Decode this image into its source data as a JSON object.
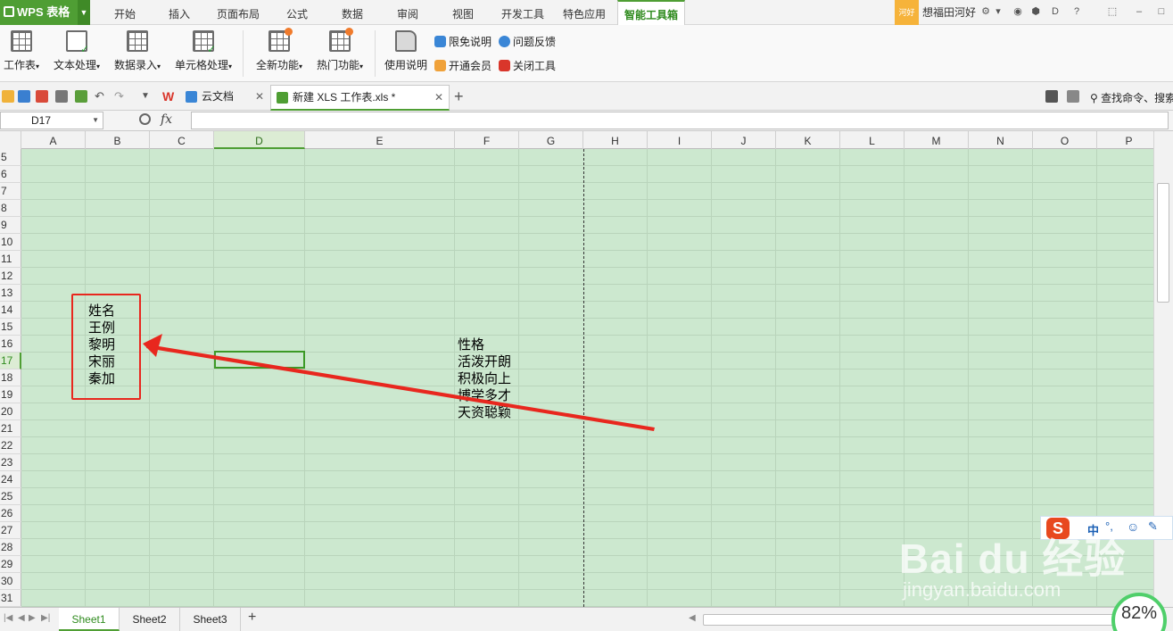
{
  "app": {
    "title": "WPS 表格"
  },
  "menu": {
    "tabs": [
      "开始",
      "插入",
      "页面布局",
      "公式",
      "数据",
      "审阅",
      "视图",
      "开发工具",
      "特色应用",
      "智能工具箱"
    ],
    "active_tab": "智能工具箱"
  },
  "user": {
    "badge": "河好",
    "name": "想福田河好"
  },
  "ribbon": {
    "items": [
      "工作表",
      "文本处理",
      "数据录入",
      "单元格处理",
      "全新功能",
      "热门功能",
      "使用说明"
    ],
    "small": [
      "限免说明",
      "问题反馈",
      "开通会员",
      "关闭工具"
    ]
  },
  "doc_tabs": {
    "cloud": "云文档",
    "file": "新建 XLS 工作表.xls *",
    "search": "查找命令、搜索"
  },
  "formula": {
    "name_box": "D17",
    "fx": "fx",
    "value": ""
  },
  "sheet": {
    "columns": [
      "A",
      "B",
      "C",
      "D",
      "E",
      "F",
      "G",
      "H",
      "I",
      "J",
      "K",
      "L",
      "M",
      "N",
      "O",
      "P"
    ],
    "selected_column": "D",
    "rows": [
      "5",
      "6",
      "7",
      "8",
      "9",
      "10",
      "11",
      "12",
      "13",
      "14",
      "15",
      "16",
      "17",
      "18",
      "19",
      "20",
      "21",
      "22",
      "23",
      "24",
      "25",
      "26",
      "27",
      "28",
      "29",
      "30",
      "31"
    ],
    "selected_row": "17",
    "column_b": [
      "姓名",
      "王例",
      "黎明",
      "宋丽",
      "秦加"
    ],
    "column_f": [
      "性格",
      "活泼开朗",
      "积极向上",
      "博学多才",
      "天资聪颖"
    ]
  },
  "sheet_tabs": [
    "Sheet1",
    "Sheet2",
    "Sheet3"
  ],
  "active_sheet": "Sheet1",
  "overlay": {
    "ime_label": "中",
    "watermark": "Bai du 经验",
    "watermark_url": "jingyan.baidu.com",
    "speed": "82%"
  },
  "colors": {
    "accent": "#4f9e34",
    "grid_bg": "#cce8cf",
    "annotation": "#e8271e"
  }
}
